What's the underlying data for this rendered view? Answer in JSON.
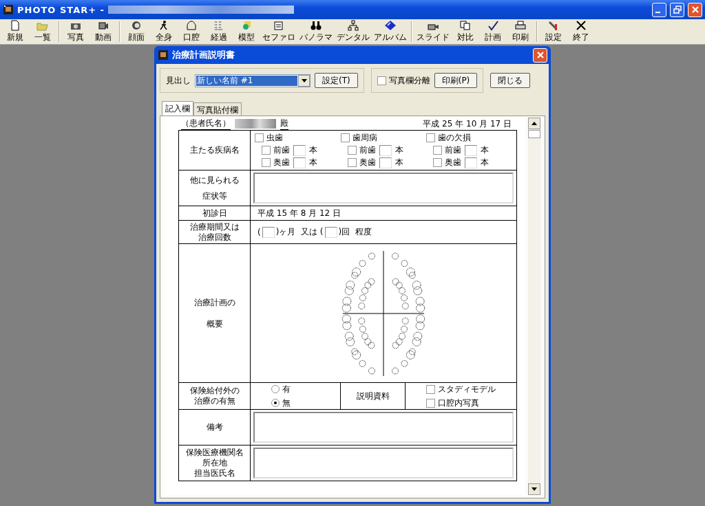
{
  "window": {
    "title": "PHOTO STAR+ -"
  },
  "toolbar": [
    [
      {
        "label": "新規"
      },
      {
        "label": "一覧"
      }
    ],
    [
      {
        "label": "写真"
      },
      {
        "label": "動画"
      }
    ],
    [
      {
        "label": "顔面"
      },
      {
        "label": "全身"
      },
      {
        "label": "口腔"
      },
      {
        "label": "経過"
      },
      {
        "label": "模型"
      },
      {
        "label": "セファロ"
      },
      {
        "label": "パノラマ"
      },
      {
        "label": "デンタル"
      },
      {
        "label": "アルバム"
      }
    ],
    [
      {
        "label": "スライド"
      },
      {
        "label": "対比"
      },
      {
        "label": "計画"
      },
      {
        "label": "印刷"
      }
    ],
    [
      {
        "label": "設定"
      },
      {
        "label": "終了"
      }
    ]
  ],
  "dialog": {
    "title": "治療計画説明書",
    "heading_label": "見出し",
    "heading_value": "新しい名前 #1",
    "set_button": "設定(T)",
    "separate": {
      "label": "写真欄分離",
      "checked": false
    },
    "print_button": "印刷(P)",
    "close_button": "閉じる",
    "tabs": [
      {
        "label": "記入欄",
        "selected": true
      },
      {
        "label": "写真貼付欄",
        "selected": false
      }
    ],
    "patient": {
      "label": "（患者氏名）",
      "suffix": "殿",
      "date": "平成 25 年 10 月 17 日"
    },
    "rows": [
      {
        "kind": "diseases",
        "label": [
          "主たる疾病名"
        ],
        "groups": [
          {
            "name": "虫歯",
            "checked": false,
            "subs": [
              {
                "label": "前歯",
                "checked": false,
                "unit": "本"
              },
              {
                "label": "奥歯",
                "checked": false,
                "unit": "本"
              }
            ]
          },
          {
            "name": "歯周病",
            "checked": false,
            "subs": [
              {
                "label": "前歯",
                "checked": false,
                "unit": "本"
              },
              {
                "label": "奥歯",
                "checked": false,
                "unit": "本"
              }
            ]
          },
          {
            "name": "歯の欠損",
            "checked": false,
            "subs": [
              {
                "label": "前歯",
                "checked": false,
                "unit": "本"
              },
              {
                "label": "奥歯",
                "checked": false,
                "unit": "本"
              }
            ]
          }
        ]
      },
      {
        "kind": "textarea",
        "label": [
          "他に見られる",
          "症状等"
        ]
      },
      {
        "kind": "text",
        "label": [
          "初診日"
        ],
        "value": "平成 15 年 8 月 12 日"
      },
      {
        "kind": "period",
        "label": [
          "治療期間又は",
          "治療回数"
        ],
        "parts": [
          "(",
          ")ヶ月  又は (",
          ")回  程度"
        ]
      },
      {
        "kind": "chart",
        "label": [
          "治療計画の",
          "概要"
        ]
      },
      {
        "kind": "insurance",
        "label": [
          "保険給付外の",
          "治療の有無"
        ],
        "radios": [
          {
            "label": "有",
            "selected": false
          },
          {
            "label": "無",
            "selected": true
          }
        ],
        "materials_label": "説明資料",
        "materials": [
          {
            "label": "スタディモデル",
            "checked": false
          },
          {
            "label": "口腔内写真",
            "checked": false
          }
        ]
      },
      {
        "kind": "textarea",
        "label": [
          "備考"
        ]
      },
      {
        "kind": "textarea",
        "label": [
          "保険医療機関名",
          "所在地",
          "担当医氏名"
        ]
      }
    ]
  }
}
